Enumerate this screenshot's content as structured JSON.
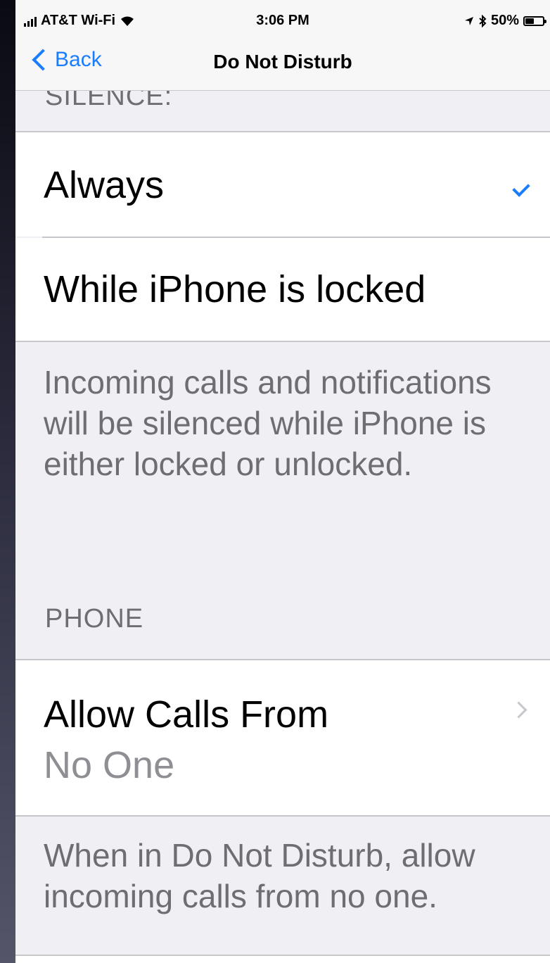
{
  "status_bar": {
    "carrier": "AT&T Wi-Fi",
    "time": "3:06 PM",
    "battery_percent": "50%",
    "battery_level": 0.5,
    "icons": [
      "signal-icon",
      "wifi-icon",
      "location-icon",
      "bluetooth-icon",
      "battery-icon"
    ]
  },
  "nav": {
    "back_label": "Back",
    "title": "Do Not Disturb"
  },
  "silence_section": {
    "header": "SILENCE:",
    "options": [
      {
        "label": "Always",
        "selected": true
      },
      {
        "label": "While iPhone is locked",
        "selected": false
      }
    ],
    "footer": "Incoming calls and notifications will be silenced while iPhone is either locked or unlocked."
  },
  "phone_section": {
    "header": "PHONE",
    "allow_calls": {
      "title": "Allow Calls From",
      "value": "No One"
    },
    "footer": "When in Do Not Disturb, allow incoming calls from no one."
  },
  "colors": {
    "accent": "#1a7cff",
    "background": "#efeff4",
    "secondary_text": "#6d6d72"
  }
}
